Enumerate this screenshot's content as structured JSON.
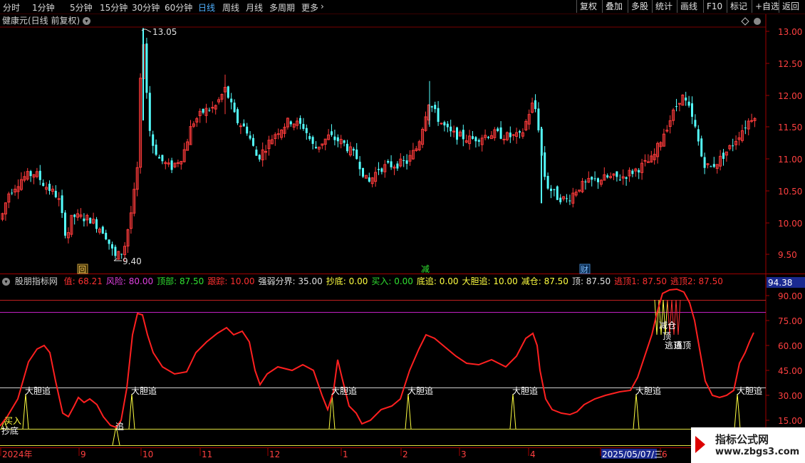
{
  "toolbar": {
    "periods": [
      "分时",
      "1分钟",
      "5分钟",
      "15分钟",
      "30分钟",
      "60分钟",
      "日线",
      "周线",
      "月线",
      "多周期",
      "更多"
    ],
    "active_period": "日线",
    "right_buttons": [
      "复权",
      "叠加",
      "多股",
      "统计",
      "画线",
      "F10",
      "标记",
      "+自选",
      "返回"
    ]
  },
  "main_chart": {
    "title": "健康元(日线 前复权)",
    "high_label": "13.05",
    "low_label": "9.40",
    "price_axis": [
      "13.00",
      "12.50",
      "12.00",
      "11.50",
      "11.00",
      "10.50",
      "10.00",
      "9.50"
    ],
    "markers": [
      "回",
      "减",
      "财"
    ]
  },
  "indicator": {
    "name": "股朋指标网",
    "items": [
      {
        "label": "值: 68.21",
        "color": "#ff3030"
      },
      {
        "label": "风险: 80.00",
        "color": "#e040e0"
      },
      {
        "label": "顶部: 87.50",
        "color": "#30e030"
      },
      {
        "label": "跟踪: 10.00",
        "color": "#ff3030"
      },
      {
        "label": "强弱分界: 35.00",
        "color": "#e0e0e0"
      },
      {
        "label": "抄底: 0.00",
        "color": "#ffff40"
      },
      {
        "label": "买入: 0.00",
        "color": "#30e030"
      },
      {
        "label": "底追: 0.00",
        "color": "#ffff40"
      },
      {
        "label": "大胆追: 10.00",
        "color": "#ffff40"
      },
      {
        "label": "减仓: 87.50",
        "color": "#ffff40"
      },
      {
        "label": "顶: 87.50",
        "color": "#e0e0e0"
      },
      {
        "label": "逃顶1: 87.50",
        "color": "#ff3030"
      },
      {
        "label": "逃顶2: 87.50",
        "color": "#ff3030"
      }
    ],
    "value_badge": "94.38",
    "axis": [
      "90.00",
      "75.00",
      "60.00",
      "45.00",
      "30.00",
      "15.00"
    ],
    "signals": {
      "dadanzhui": "大胆追",
      "zhui": "追",
      "chaodi": "抄底",
      "mairu": "买入",
      "jiancang": "减仓",
      "ding": "顶",
      "taoding1": "逃顶",
      "taoding2": "逃顶"
    }
  },
  "date_axis": {
    "labels": [
      "2024年",
      "9",
      "10",
      "11",
      "12",
      "1",
      "2",
      "3",
      "4",
      "2025/05/07/三",
      "6"
    ]
  },
  "watermark": {
    "title": "指标公式网",
    "url": "www.zbgs3.com"
  },
  "colors": {
    "up": "#ff3b3b",
    "down": "#54ffff",
    "line": "#ff2020",
    "risk": "#e040e0",
    "signal": "#ffff40"
  }
}
